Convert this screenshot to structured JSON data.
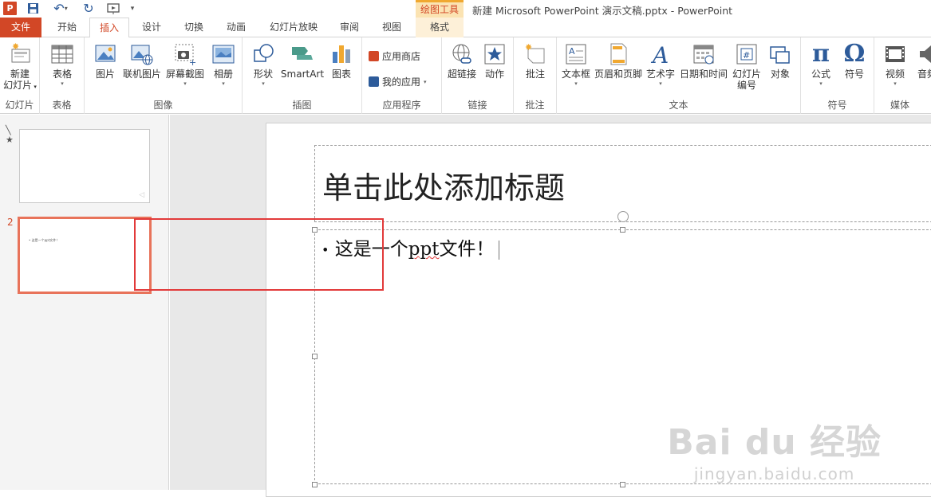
{
  "titlebar": {
    "logo_letter": "P",
    "context_tab_label": "绘图工具",
    "window_title": "新建 Microsoft PowerPoint 演示文稿.pptx - PowerPoint"
  },
  "tabs": {
    "file": "文件",
    "home": "开始",
    "insert": "插入",
    "design": "设计",
    "transitions": "切换",
    "animations": "动画",
    "slideshow": "幻灯片放映",
    "review": "审阅",
    "view": "视图",
    "format": "格式"
  },
  "ribbon": {
    "slides_group": {
      "label": "幻灯片",
      "new_slide_line1": "新建",
      "new_slide_line2": "幻灯片"
    },
    "tables_group": {
      "label": "表格",
      "table": "表格"
    },
    "images_group": {
      "label": "图像",
      "pictures": "图片",
      "online_pictures": "联机图片",
      "screenshot": "屏幕截图",
      "album": "相册"
    },
    "illustrations_group": {
      "label": "插图",
      "shapes": "形状",
      "smartart": "SmartArt",
      "chart": "图表"
    },
    "apps_group": {
      "label": "应用程序",
      "store": "应用商店",
      "my_apps": "我的应用"
    },
    "links_group": {
      "label": "链接",
      "hyperlink": "超链接",
      "action": "动作"
    },
    "comments_group": {
      "label": "批注",
      "comment": "批注"
    },
    "text_group": {
      "label": "文本",
      "textbox": "文本框",
      "header_footer": "页眉和页脚",
      "wordart": "艺术字",
      "datetime": "日期和时间",
      "slide_number_line1": "幻灯片",
      "slide_number_line2": "编号",
      "object": "对象"
    },
    "symbols_group": {
      "label": "符号",
      "equation": "公式",
      "symbol": "符号"
    },
    "media_group": {
      "label": "媒体",
      "video": "视频",
      "audio": "音频"
    }
  },
  "thumbnails": {
    "slide2_number": "2",
    "slide2_text": "• 这是一个ppt文件！"
  },
  "slide": {
    "title_placeholder": "单击此处添加标题",
    "bullet": "•",
    "body_prefix": "这是一个",
    "body_squiggle": "ppt",
    "body_suffix": "文件！"
  },
  "watermark": {
    "logo": "Bai du 经验",
    "url": "jingyan.baidu.com"
  },
  "colors": {
    "accent": "#d24726",
    "selection_highlight": "#e23a3a",
    "thumb_selected": "#e8735a"
  }
}
